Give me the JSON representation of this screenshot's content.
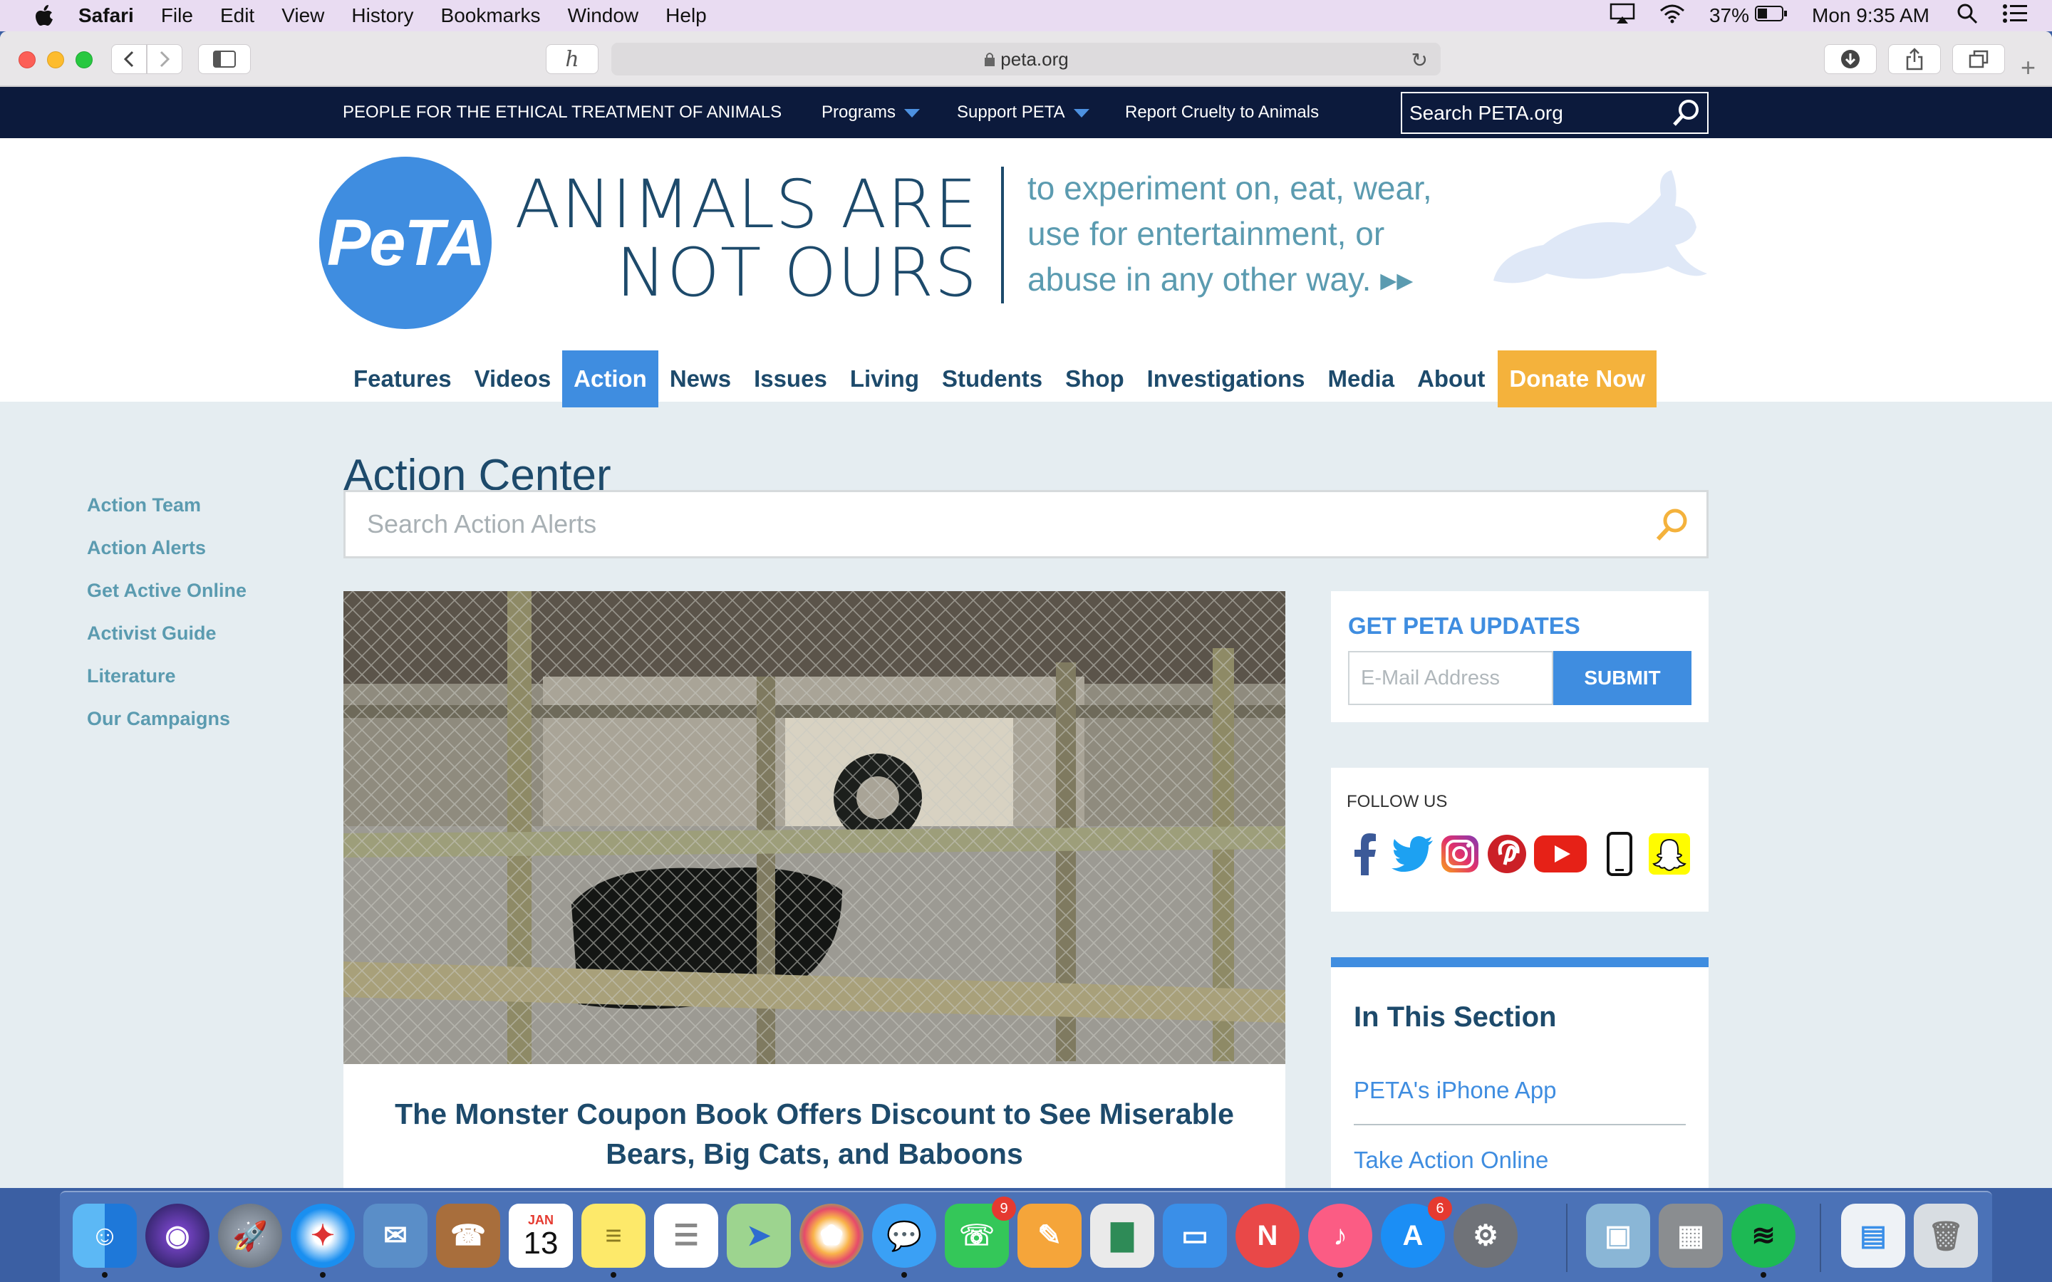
{
  "menubar": {
    "app": "Safari",
    "items": [
      "File",
      "Edit",
      "View",
      "History",
      "Bookmarks",
      "Window",
      "Help"
    ],
    "battery": "37%",
    "clock": "Mon 9:35 AM"
  },
  "browser": {
    "url": "peta.org"
  },
  "topnav": {
    "org": "PEOPLE FOR THE ETHICAL TREATMENT OF ANIMALS",
    "programs": "Programs",
    "support": "Support PETA",
    "report": "Report Cruelty to Animals",
    "search_placeholder": "Search PETA.org"
  },
  "header": {
    "logo_text": "PeTA",
    "tagline_line1": "ANIMALS ARE",
    "tagline_line2": "NOT OURS",
    "sub_line1": "to experiment on, eat, wear,",
    "sub_line2": "use for entertainment, or",
    "sub_line3": "abuse in any other way. ▸▸"
  },
  "mainnav": [
    "Features",
    "Videos",
    "Action",
    "News",
    "Issues",
    "Living",
    "Students",
    "Shop",
    "Investigations",
    "Media",
    "About"
  ],
  "mainnav_active": "Action",
  "donate": "Donate Now",
  "sidenav": [
    "Action Team",
    "Action Alerts",
    "Get Active Online",
    "Activist Guide",
    "Literature",
    "Our Campaigns"
  ],
  "action_center": {
    "title": "Action Center",
    "search_placeholder": "Search Action Alerts"
  },
  "article": {
    "title": "The Monster Coupon Book Offers Discount to See Miserable Bears, Big Cats, and Baboons"
  },
  "updates": {
    "title": "GET PETA UPDATES",
    "email_placeholder": "E-Mail Address",
    "submit": "SUBMIT"
  },
  "follow": {
    "title": "FOLLOW US",
    "networks": [
      "facebook",
      "twitter",
      "instagram",
      "pinterest",
      "youtube",
      "mobile",
      "snapchat"
    ]
  },
  "section": {
    "title": "In This Section",
    "links": [
      "PETA's iPhone App",
      "Take Action Online"
    ]
  },
  "dock": {
    "calendar_month": "JAN",
    "calendar_day": "13",
    "facetime_badge": "9",
    "appstore_badge": "6"
  },
  "colors": {
    "peta_blue": "#3f8de0",
    "navy": "#0c1a3c",
    "donate_yellow": "#f4b23c",
    "text_dark": "#1d4a6b"
  }
}
